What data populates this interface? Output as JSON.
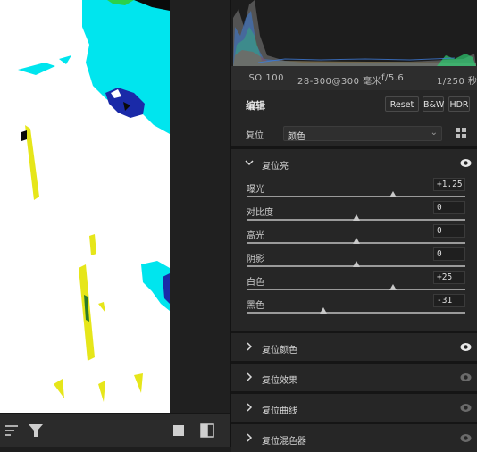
{
  "histogram": {
    "colors": {
      "red": "#c0392b",
      "green": "#2ecc71",
      "blue": "#3d7bd8",
      "gray": "#9a9a9a"
    }
  },
  "exif": {
    "iso": "ISO 100",
    "lens": "28-300@300 毫米",
    "aperture": "f/5.6",
    "shutter": "1/250 秒"
  },
  "edit": {
    "title": "编辑",
    "reset_label": "Reset",
    "bw_label": "B&W",
    "hdr_label": "HDR"
  },
  "profile": {
    "label": "复位",
    "value": "颜色",
    "chevron": "⌄"
  },
  "light": {
    "title": "复位亮",
    "sliders": [
      {
        "label": "曝光",
        "value": "+1.25",
        "level": 0.67
      },
      {
        "label": "对比度",
        "value": "0",
        "level": 0.5
      },
      {
        "label": "高光",
        "value": "0",
        "level": 0.5
      },
      {
        "label": "阴影",
        "value": "0",
        "level": 0.5
      },
      {
        "label": "白色",
        "value": "+25",
        "level": 0.67
      },
      {
        "label": "黑色",
        "value": "-31",
        "level": 0.35
      }
    ]
  },
  "sections": [
    {
      "title": "复位颜色",
      "eye_active": true
    },
    {
      "title": "复位效果",
      "eye_active": false
    },
    {
      "title": "复位曲线",
      "eye_active": false
    },
    {
      "title": "复位混色器",
      "eye_active": false
    }
  ],
  "colors": {
    "accent_eye": "#e8e8e8",
    "muted_eye": "#6a6a6a",
    "clip_cyan": "#00e5ee",
    "clip_blue": "#1a2aa8",
    "clip_yellow": "#e6e61a",
    "image_white": "#ffffff"
  }
}
